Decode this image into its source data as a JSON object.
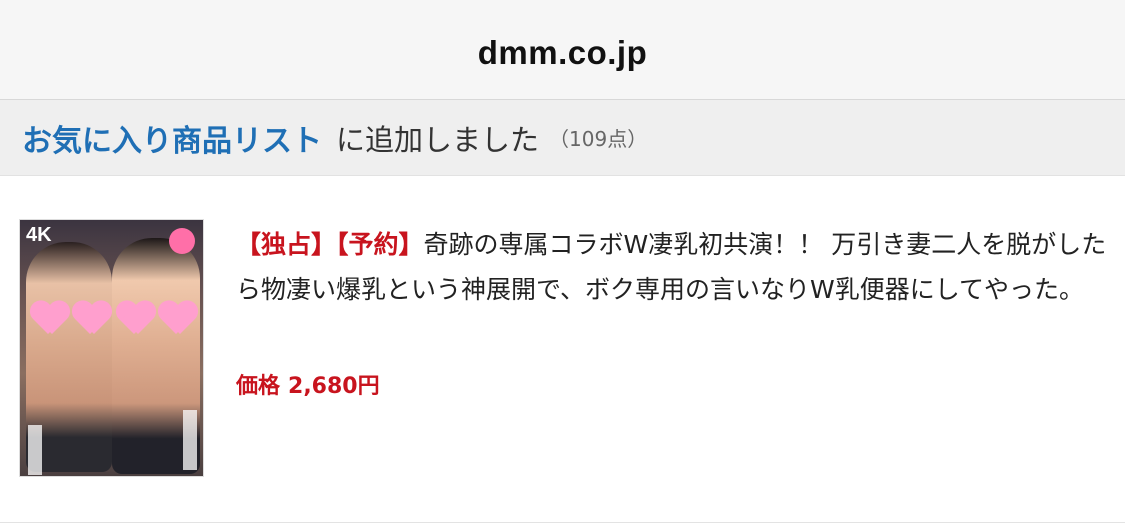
{
  "browser": {
    "url": "dmm.co.jp"
  },
  "notice": {
    "link_label": "お気に入り商品リスト",
    "message": "に追加しました",
    "count": "（109点）"
  },
  "item": {
    "thumbnail_badge": "4K",
    "tags": [
      "【独占】",
      "【予約】"
    ],
    "title": "奇跡の専属コラボW凄乳初共演！！ 万引き妻二人を脱がしたら物凄い爆乳という神展開で、ボク専用の言いなりW乳便器にしてやった。",
    "price_label": "価格",
    "price_value": "2,680円"
  },
  "colors": {
    "link": "#1f6fb5",
    "accent": "#c8141e"
  }
}
